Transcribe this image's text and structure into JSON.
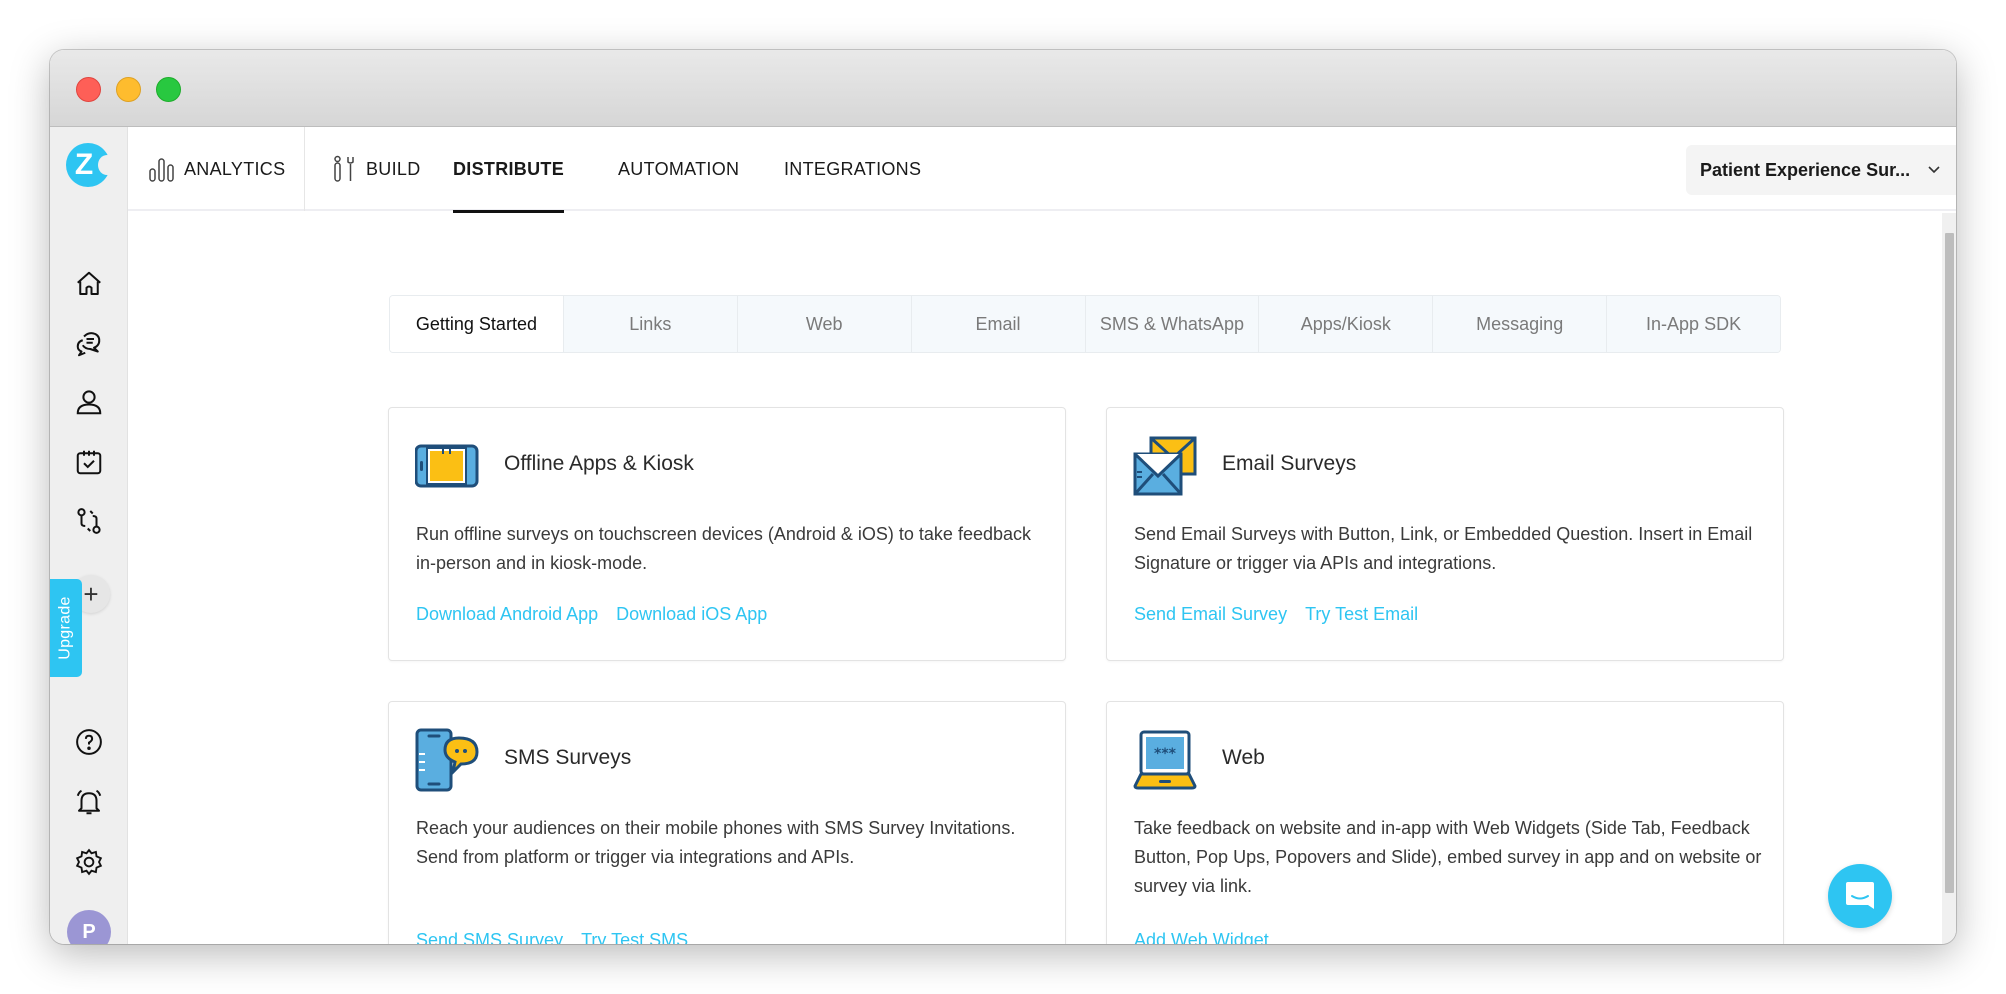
{
  "window": {
    "controls": [
      "close",
      "minimize",
      "maximize"
    ]
  },
  "sidebar": {
    "logo_letter": "Z",
    "items": [
      {
        "name": "home",
        "icon": "home-icon"
      },
      {
        "name": "conversations",
        "icon": "chat-icon"
      },
      {
        "name": "contacts",
        "icon": "user-icon"
      },
      {
        "name": "tasks",
        "icon": "calendar-check-icon"
      },
      {
        "name": "workflows",
        "icon": "workflow-icon"
      }
    ],
    "add_label": "+",
    "upgrade_label": "Upgrade",
    "bottom_items": [
      {
        "name": "help",
        "icon": "help-icon"
      },
      {
        "name": "notifications",
        "icon": "bell-icon"
      },
      {
        "name": "settings",
        "icon": "gear-icon"
      }
    ],
    "avatar_initial": "P",
    "avatar_color": "#9b96d4"
  },
  "topnav": {
    "items": [
      {
        "label": "ANALYTICS",
        "icon": "analytics-icon",
        "active": false
      },
      {
        "label": "BUILD",
        "icon": "build-tools-icon",
        "active": false
      },
      {
        "label": "DISTRIBUTE",
        "active": true
      },
      {
        "label": "AUTOMATION",
        "active": false
      },
      {
        "label": "INTEGRATIONS",
        "active": false
      }
    ],
    "survey_selector": "Patient Experience Sur..."
  },
  "tabs": [
    {
      "label": "Getting Started",
      "active": true
    },
    {
      "label": "Links"
    },
    {
      "label": "Web"
    },
    {
      "label": "Email"
    },
    {
      "label": "SMS & WhatsApp"
    },
    {
      "label": "Apps/Kiosk"
    },
    {
      "label": "Messaging"
    },
    {
      "label": "In-App SDK"
    }
  ],
  "cards": [
    {
      "title": "Offline Apps & Kiosk",
      "icon": "tablet-kiosk-icon",
      "description": "Run offline surveys on touchscreen devices (Android & iOS) to take feedback in-person and in kiosk-mode.",
      "links": [
        "Download Android App",
        "Download iOS App"
      ]
    },
    {
      "title": "Email Surveys",
      "icon": "envelope-icon",
      "description": "Send Email Surveys with Button, Link, or Embedded Question. Insert in Email Signature or trigger via APIs and integrations.",
      "links": [
        "Send Email Survey",
        "Try Test Email"
      ]
    },
    {
      "title": "SMS Surveys",
      "icon": "sms-phone-icon",
      "description": "Reach your audiences on their mobile phones with SMS Survey Invitations. Send from platform or trigger via integrations and APIs.",
      "links": [
        "Send SMS Survey",
        "Try Test SMS"
      ]
    },
    {
      "title": "Web",
      "icon": "laptop-icon",
      "description": "Take feedback on website and in-app with Web Widgets (Side Tab, Feedback Button, Pop Ups, Popovers and Slide), embed survey in app and on website or survey via link.",
      "links": [
        "Add Web Widget"
      ]
    }
  ],
  "colors": {
    "accent": "#2ec5f2",
    "icon_blue": "#5aaee0",
    "icon_dark": "#1f4e7a",
    "icon_yellow": "#fbbf14"
  }
}
